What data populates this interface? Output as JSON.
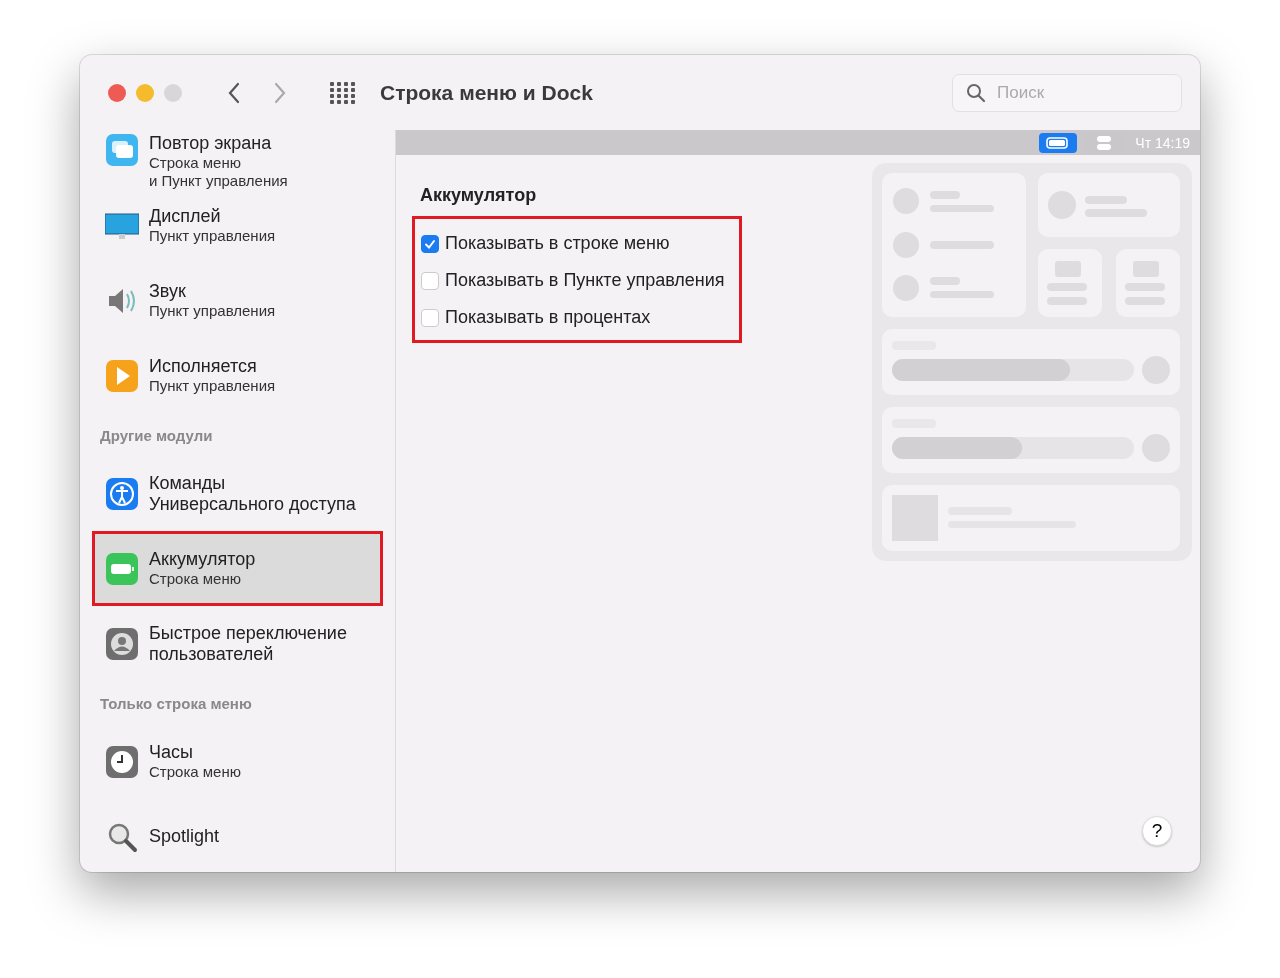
{
  "window": {
    "title": "Строка меню и Dock"
  },
  "search": {
    "placeholder": "Поиск"
  },
  "sidebar": {
    "groups": [
      {
        "items": [
          {
            "title": "Повтор экрана",
            "subtitle": "Строка меню\nи Пункт управления",
            "selected": false,
            "outlined": false
          },
          {
            "title": "Дисплей",
            "subtitle": "Пункт управления",
            "selected": false,
            "outlined": false
          },
          {
            "title": "Звук",
            "subtitle": "Пункт управления",
            "selected": false,
            "outlined": false
          },
          {
            "title": "Исполняется",
            "subtitle": "Пункт управления",
            "selected": false,
            "outlined": false
          }
        ]
      },
      {
        "heading": "Другие модули",
        "items": [
          {
            "title": "Команды\nУниверсального доступа",
            "selected": false,
            "outlined": false
          },
          {
            "title": "Аккумулятор",
            "subtitle": "Строка меню",
            "selected": true,
            "outlined": true
          },
          {
            "title": "Быстрое переключение\nпользователей",
            "selected": false,
            "outlined": false
          }
        ]
      },
      {
        "heading": "Только строка меню",
        "items": [
          {
            "title": "Часы",
            "subtitle": "Строка меню",
            "selected": false,
            "outlined": false
          },
          {
            "title": "Spotlight",
            "selected": false,
            "outlined": false
          }
        ]
      }
    ]
  },
  "menubar_preview": {
    "clock": "Чт 14:19"
  },
  "section": {
    "title": "Аккумулятор",
    "outlined": true,
    "options": [
      {
        "label": "Показывать в строке меню",
        "checked": true
      },
      {
        "label": "Показывать в Пункте управления",
        "checked": false
      },
      {
        "label": "Показывать в процентах",
        "checked": false
      }
    ]
  },
  "help": {
    "label": "?"
  }
}
